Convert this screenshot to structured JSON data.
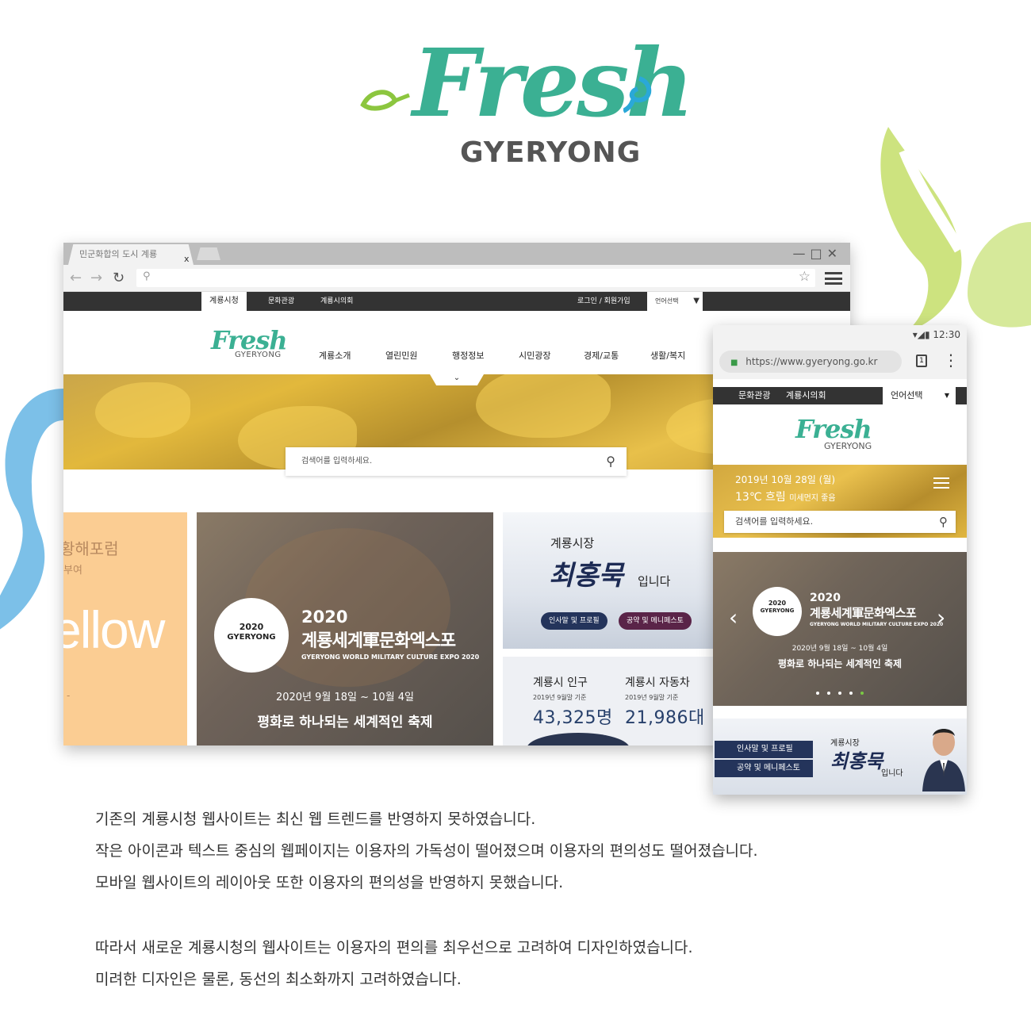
{
  "brand": {
    "wordmark": "Fresh",
    "subtitle": "GYERYONG",
    "colors": {
      "green": "#3bb093",
      "lime": "#c9e17a",
      "sky": "#7cc0e8",
      "navy": "#24345b"
    }
  },
  "desktop": {
    "tab_title": "민군화합의 도시 계룡",
    "tab_close": "x",
    "icons": [
      "back-arrow-icon",
      "forward-arrow-icon",
      "reload-icon",
      "search-icon",
      "star-icon",
      "menu-icon"
    ],
    "util": {
      "active": "계룡시청",
      "tab1": "문화관광",
      "tab2": "계룡시의회",
      "login": "로그인 / 회원가입",
      "lang": "언어선택"
    },
    "nav": [
      "계룡소개",
      "열린민원",
      "행정정보",
      "시민광장",
      "경제/교통",
      "생활/복지"
    ],
    "search_placeholder": "검색어를 입력하세요.",
    "promo": {
      "line1": "황해포럼",
      "line2": "부여",
      "big": "ellow",
      "dash": "-"
    },
    "expo": {
      "emblem_year": "2020",
      "emblem_name": "GYERYONG",
      "year": "2020",
      "title": "계룡세계軍문화엑스포",
      "english": "GYERYONG WORLD MILITARY CULTURE EXPO 2020",
      "date": "2020년 9월 18일 ~ 10월 4일",
      "slogan": "평화로 하나되는 세계적인 축제"
    },
    "mayor": {
      "label": "계룡시장",
      "name": "최홍묵",
      "suffix": "입니다",
      "btn1": "인사말 및 프로필",
      "btn2": "공약 및 메니페스토"
    },
    "stats": {
      "population": {
        "title": "계룡시 인구",
        "date": "2019년 9월말 기준",
        "value": "43,325명"
      },
      "cars": {
        "title": "계룡시 자동차",
        "date": "2019년 9월말 기준",
        "value": "21,986대"
      }
    }
  },
  "mobile": {
    "time": "12:30",
    "url": "https://www.gyeryong.go.kr",
    "tab_count": "1",
    "util": {
      "tab1": "문화관광",
      "tab2": "계룡시의회",
      "lang": "언어선택"
    },
    "date": "2019년 10월 28일 (월)",
    "temp": "13℃ 흐림",
    "dust": "미세먼지 좋음",
    "search_placeholder": "검색어를 입력하세요.",
    "expo": {
      "emblem_year": "2020",
      "emblem_name": "GYERYONG",
      "year": "2020",
      "title": "계룡세계軍문화엑스포",
      "english": "GYERYONG WORLD MILITARY CULTURE EXPO 2020",
      "date": "2020년 9월 18일 ~ 10월 4일",
      "slogan": "평화로 하나되는 세계적인 축제"
    },
    "mayor": {
      "label": "계룡시장",
      "name": "최홍묵",
      "suffix": "입니다",
      "btn1": "인사말 및 프로필",
      "btn2": "공약 및 메니페스토"
    }
  },
  "description": [
    "기존의 계룡시청 웹사이트는 최신 웹 트렌드를 반영하지 못하였습니다.",
    "작은 아이콘과 텍스트 중심의 웹페이지는 이용자의 가독성이 떨어졌으며 이용자의 편의성도 떨어졌습니다.",
    "모바일 웹사이트의 레이아웃 또한 이용자의 편의성을 반영하지 못했습니다.",
    "따라서 새로운 계룡시청의 웹사이트는 이용자의 편의를 최우선으로 고려하여 디자인하였습니다.",
    "미려한 디자인은 물론, 동선의 최소화까지 고려하였습니다."
  ]
}
